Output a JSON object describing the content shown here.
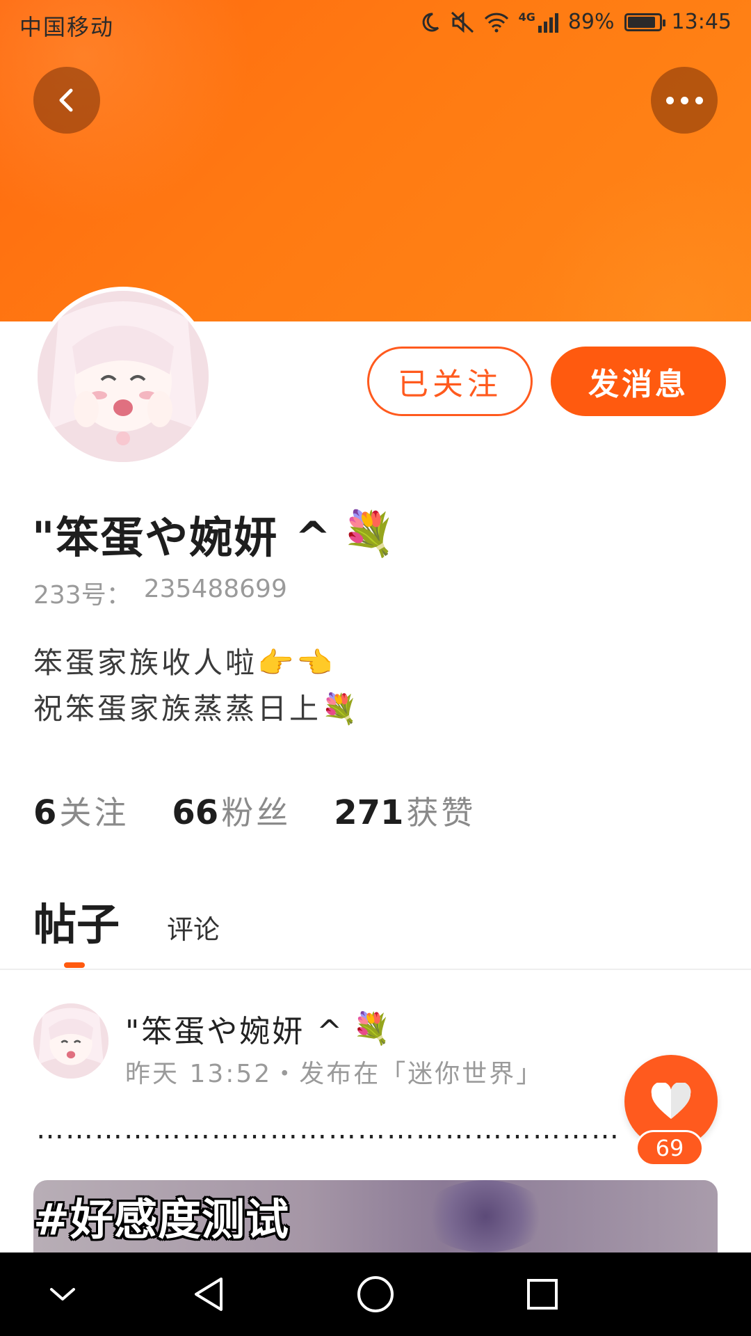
{
  "status_bar": {
    "carrier": "中国移动",
    "network": "4G",
    "battery": "89%",
    "battery_level": 0.89,
    "time": "13:45"
  },
  "header": {
    "back_icon": "chevron-left-icon",
    "more_icon": "more-dots-icon",
    "banner_color": "#ff7a12"
  },
  "profile": {
    "nickname": "\"笨蛋や婉妍 ^",
    "nickname_emoji": "💐",
    "id_label": "233号：",
    "id_value": "235488699",
    "bio_line1": "笨蛋家族收人啦👉👈",
    "bio_line2": "祝笨蛋家族蒸蒸日上💐",
    "follow_button": "已关注",
    "message_button": "发消息",
    "accent_color": "#ff5a0f"
  },
  "stats": [
    {
      "value": "6",
      "label": "关注"
    },
    {
      "value": "66",
      "label": "粉丝"
    },
    {
      "value": "271",
      "label": "获赞"
    }
  ],
  "tabs": {
    "active": "帖子",
    "other": "评论"
  },
  "post": {
    "author": "\"笨蛋や婉妍 ^",
    "author_emoji": "💐",
    "meta": "昨天 13:52・发布在「迷你世界」",
    "text": "……………………………………………………",
    "hashtag": "#好感度测试",
    "likes": "69"
  },
  "nav": {
    "hide_icon": "chevron-down-icon",
    "back_icon": "triangle-back-icon",
    "home_icon": "circle-home-icon",
    "recent_icon": "square-recent-icon"
  }
}
